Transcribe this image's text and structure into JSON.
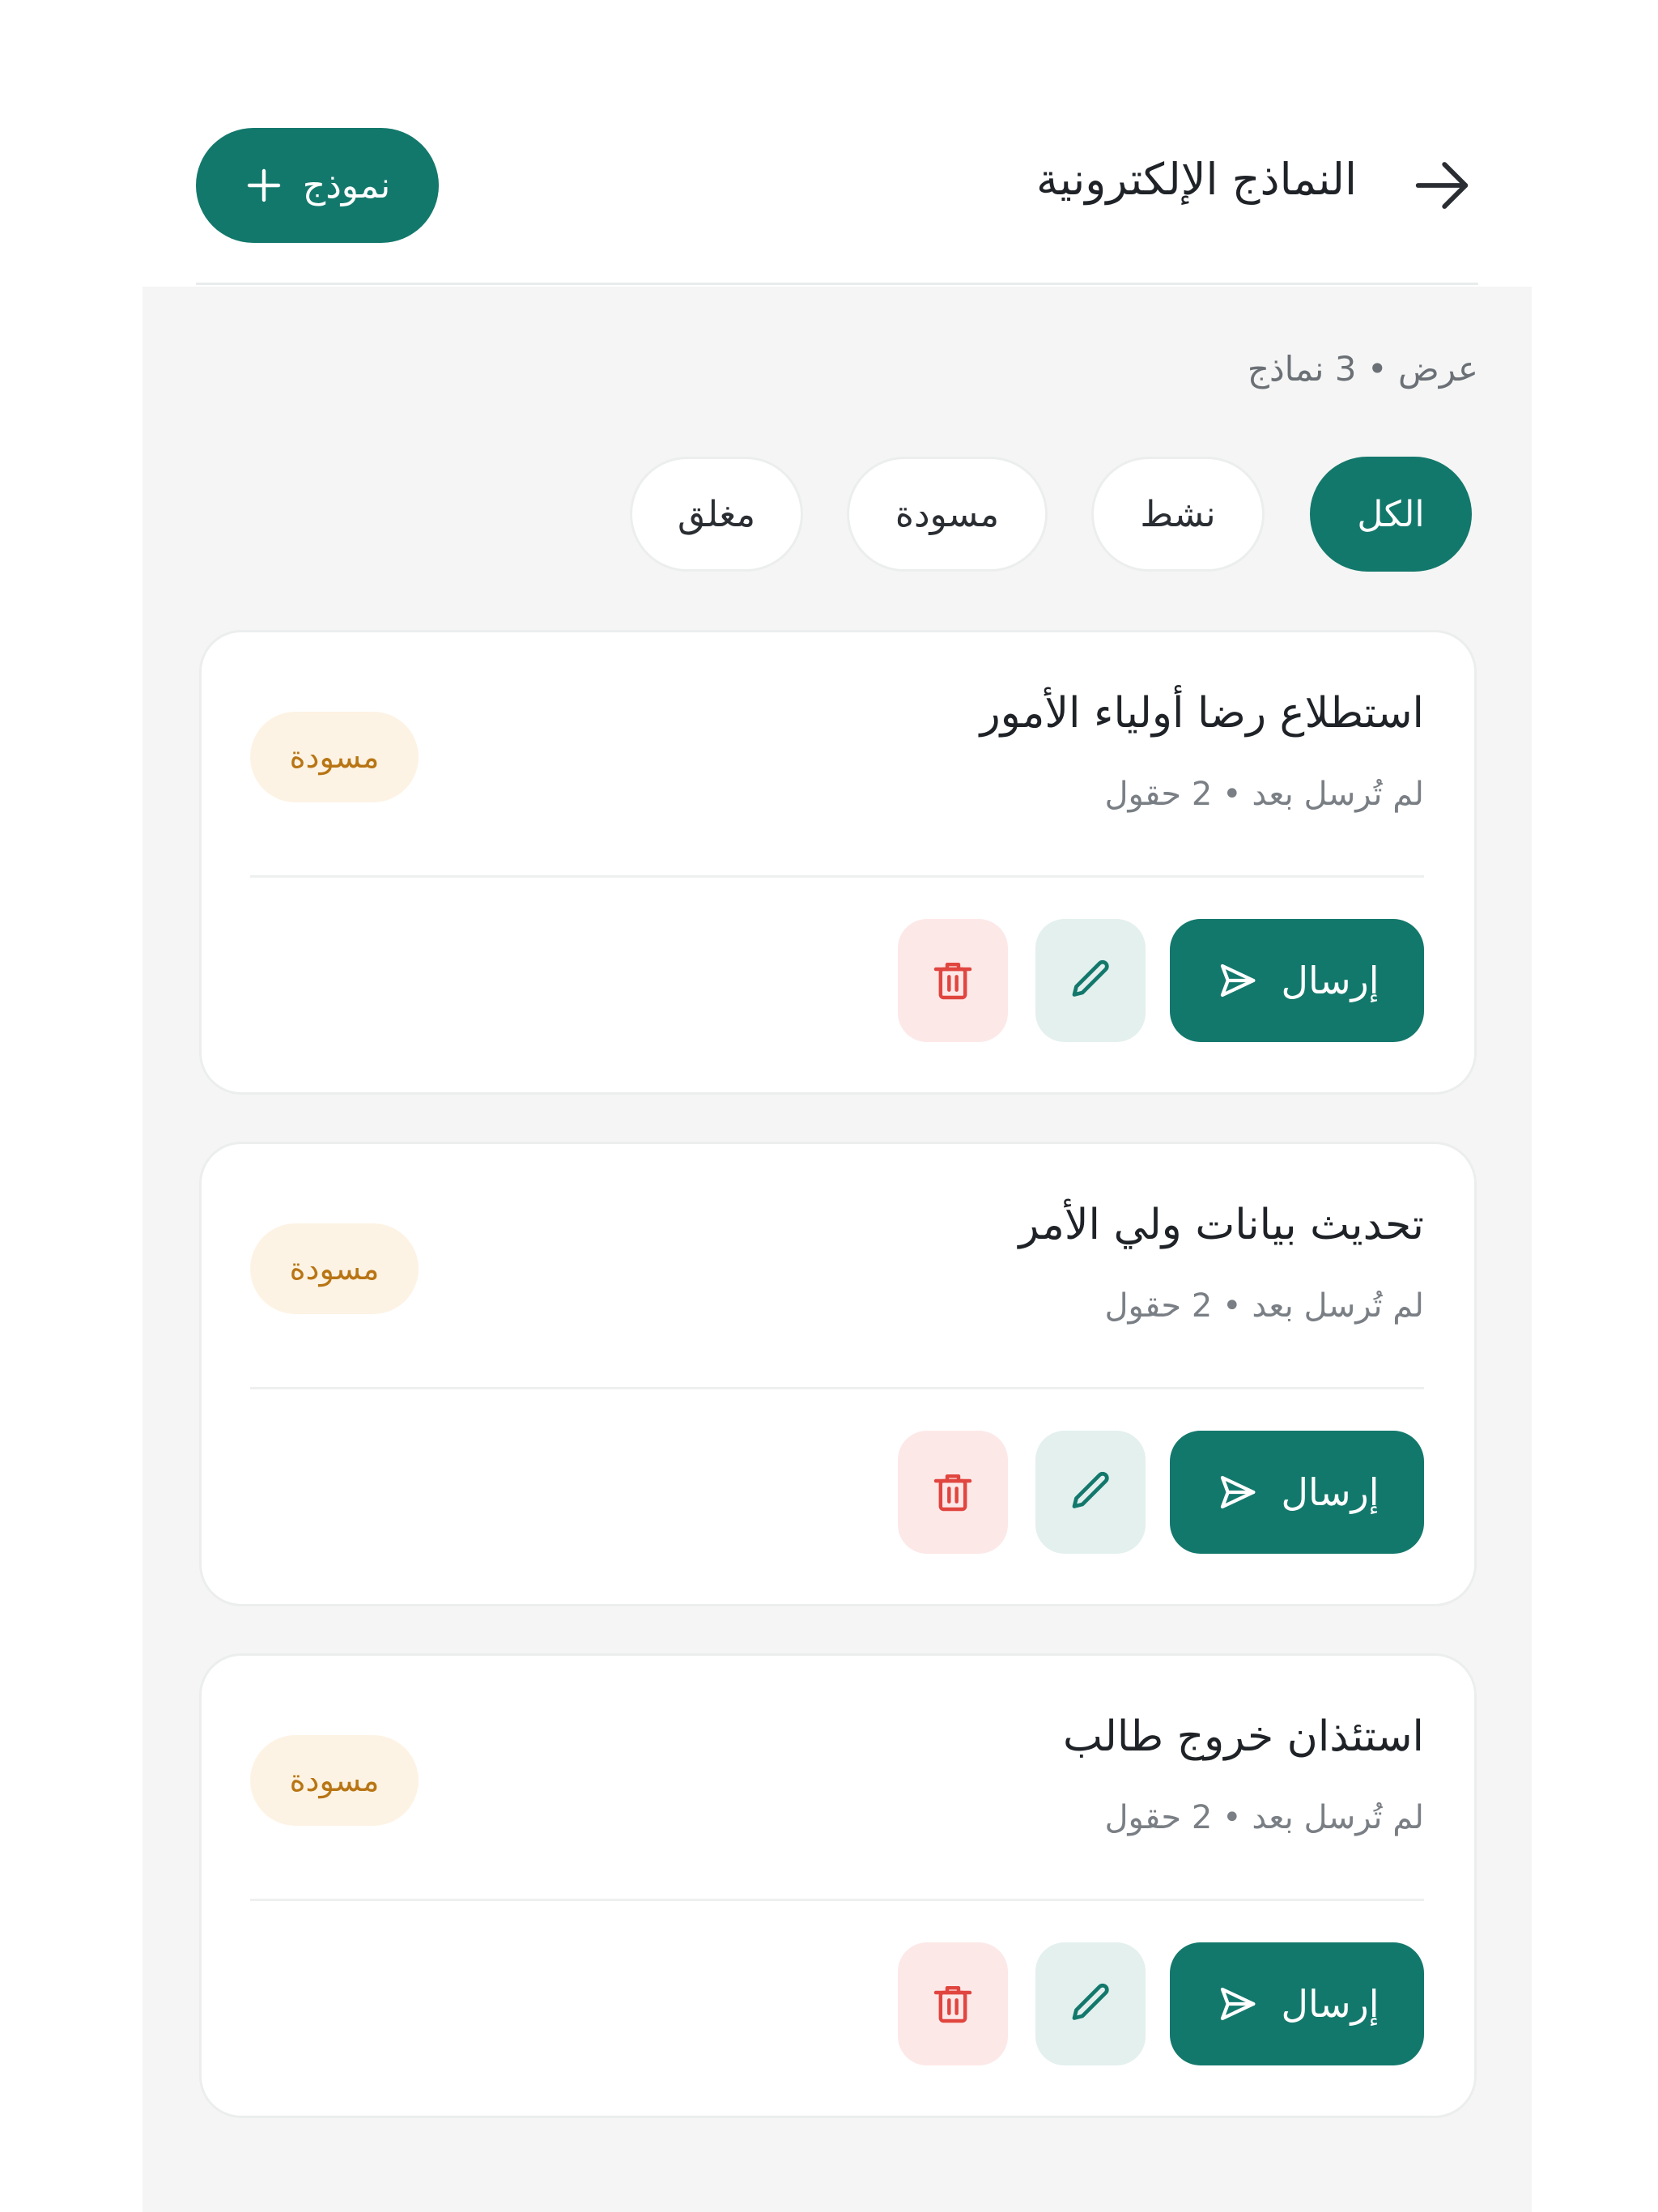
{
  "header": {
    "title": "النماذج الإلكترونية",
    "new_form_label": "نموذج",
    "back_icon": "arrow-right-icon"
  },
  "summary": {
    "count_text": "عرض • 3 نماذج"
  },
  "filters": [
    {
      "label": "الكل",
      "active": true
    },
    {
      "label": "نشط",
      "active": false
    },
    {
      "label": "مسودة",
      "active": false
    },
    {
      "label": "مغلق",
      "active": false
    }
  ],
  "forms": [
    {
      "title": "استطلاع رضا أولياء الأمور",
      "meta": "لم تُرسل بعد • 2 حقول",
      "status": "مسودة"
    },
    {
      "title": "تحديث بيانات ولي الأمر",
      "meta": "لم تُرسل بعد • 2 حقول",
      "status": "مسودة"
    },
    {
      "title": "استئذان خروج طالب",
      "meta": "لم تُرسل بعد • 2 حقول",
      "status": "مسودة"
    }
  ],
  "actions": {
    "send_label": "إرسال"
  },
  "colors": {
    "primary": "#13786c",
    "draft_bg": "#fdf3e4",
    "draft_text": "#b87514",
    "delete_bg": "#fde8e8",
    "delete_icon": "#e0463f",
    "edit_bg": "#e3f0ee",
    "page_bg": "#f4f5f4"
  }
}
